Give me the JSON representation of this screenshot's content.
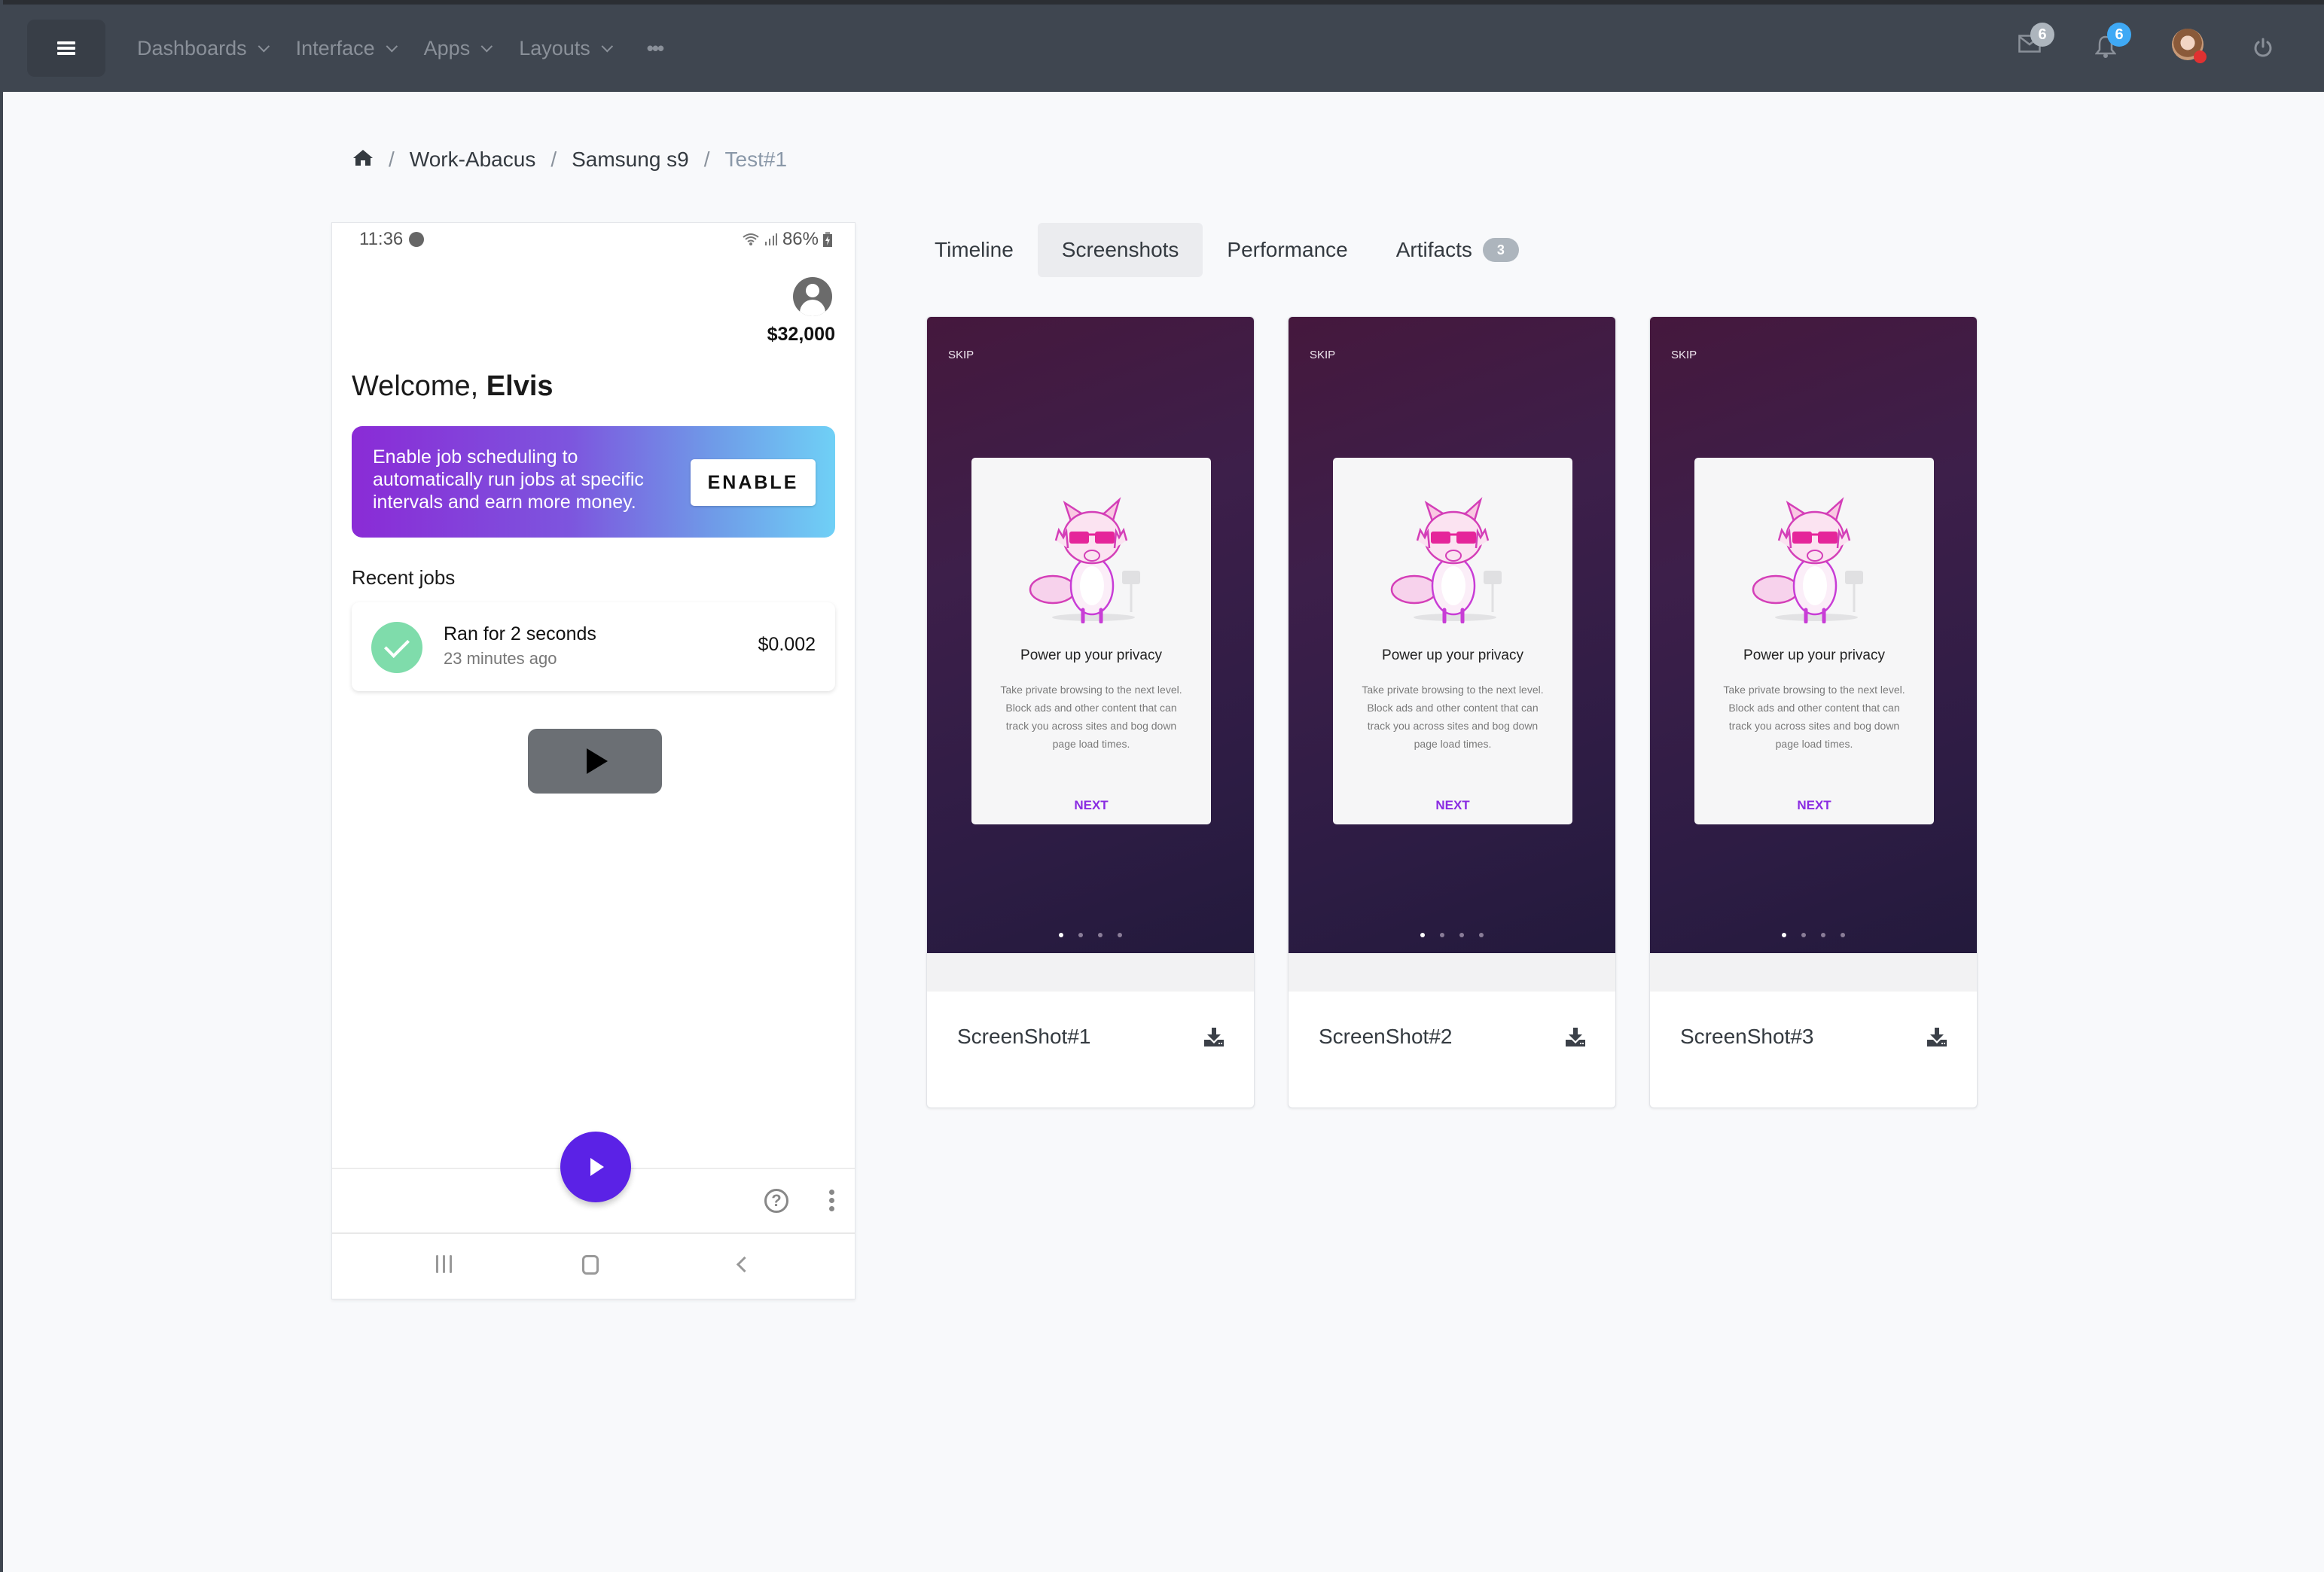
{
  "header": {
    "menu_icon": "hamburger-icon",
    "nav": [
      {
        "label": "Dashboards"
      },
      {
        "label": "Interface"
      },
      {
        "label": "Apps"
      },
      {
        "label": "Layouts"
      }
    ],
    "more_icon": "ellipsis-icon",
    "messages_badge": "6",
    "notifications_badge": "6",
    "colors": {
      "bar": "#3f4650",
      "msg_badge": "#adb5bd",
      "notif_badge": "#3fa9f5",
      "status_dot": "#e03131"
    }
  },
  "breadcrumb": {
    "home_icon": "home-icon",
    "items": [
      "Work-Abacus",
      "Samsung s9"
    ],
    "current": "Test#1"
  },
  "phone": {
    "status_time": "11:36",
    "status_battery": "86%",
    "balance": "$32,000",
    "welcome_prefix": "Welcome, ",
    "welcome_name": "Elvis",
    "promo_text": "Enable job scheduling to automatically run jobs at specific intervals and earn more money.",
    "promo_button": "ENABLE",
    "recent_label": "Recent jobs",
    "jobs": [
      {
        "title": "Ran for 2 seconds",
        "time": "23 minutes ago",
        "amount": "$0.002",
        "status": "success"
      }
    ],
    "help_glyph": "?",
    "accent": "#5b22e6"
  },
  "tabs": [
    {
      "label": "Timeline",
      "active": false
    },
    {
      "label": "Screenshots",
      "active": true
    },
    {
      "label": "Performance",
      "active": false
    },
    {
      "label": "Artifacts",
      "active": false,
      "count": "3"
    }
  ],
  "screenshots": [
    {
      "label": "ScreenShot#1",
      "skip": "SKIP",
      "title": "Power up your privacy",
      "body": "Take private browsing to the next level. Block ads and other content that can track you across sites and bog down page load times.",
      "next": "NEXT",
      "page_indicator": {
        "active": 1,
        "total": 4
      }
    },
    {
      "label": "ScreenShot#2",
      "skip": "SKIP",
      "title": "Power up your privacy",
      "body": "Take private browsing to the next level. Block ads and other content that can track you across sites and bog down page load times.",
      "next": "NEXT",
      "page_indicator": {
        "active": 1,
        "total": 4
      }
    },
    {
      "label": "ScreenShot#3",
      "skip": "SKIP",
      "title": "Power up your privacy",
      "body": "Take private browsing to the next level. Block ads and other content that can track you across sites and bog down page load times.",
      "next": "NEXT",
      "page_indicator": {
        "active": 1,
        "total": 4
      }
    }
  ]
}
